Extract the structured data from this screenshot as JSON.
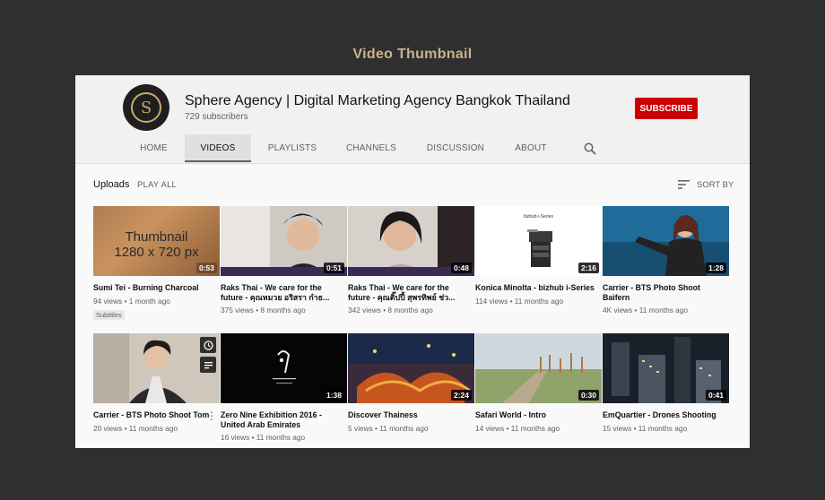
{
  "page": {
    "heading": "Video Thumbnail"
  },
  "channel": {
    "avatar_letter": "S",
    "name": "Sphere Agency | Digital Marketing Agency Bangkok Thailand",
    "subscribers": "729 subscribers",
    "subscribe_label": "SUBSCRIBE",
    "brand_color": "#cc0000"
  },
  "tabs": [
    {
      "label": "HOME",
      "active": false
    },
    {
      "label": "VIDEOS",
      "active": true
    },
    {
      "label": "PLAYLISTS",
      "active": false
    },
    {
      "label": "CHANNELS",
      "active": false
    },
    {
      "label": "DISCUSSION",
      "active": false
    },
    {
      "label": "ABOUT",
      "active": false
    }
  ],
  "uploads": {
    "title": "Uploads",
    "play_all": "PLAY ALL",
    "sort_by": "SORT BY"
  },
  "videos": [
    {
      "placeholder_line1": "Thumbnail",
      "placeholder_line2": "1280 x 720 px",
      "duration": "0:53",
      "title": "Sumi Tei - Burning Charcoal",
      "views": "94 views",
      "age": "1 month ago",
      "badge": "Subtitles"
    },
    {
      "duration": "0:51",
      "title": "Raks Thai - We care for the future - คุณหมวย อริสรา กำธ...",
      "views": "375 views",
      "age": "8 months ago"
    },
    {
      "duration": "0:48",
      "title": "Raks Thai - We care for the future - คุณติ๊ปปี้ สุพรทิพย์ ช่ว...",
      "views": "342 views",
      "age": "8 months ago"
    },
    {
      "duration": "2:16",
      "title": "Konica Minolta - bizhub i-Series",
      "views": "114 views",
      "age": "11 months ago",
      "thumb_text": "bizhub i-Series"
    },
    {
      "duration": "1:28",
      "title": "Carrier - BTS Photo Shoot Baifern",
      "views": "4K views",
      "age": "11 months ago"
    },
    {
      "duration": "",
      "title": "Carrier - BTS Photo Shoot Tom",
      "views": "20 views",
      "age": "11 months ago"
    },
    {
      "duration": "1:38",
      "title": "Zero Nine Exhibition 2016 - United Arab Emirates",
      "views": "16 views",
      "age": "11 months ago"
    },
    {
      "duration": "2:24",
      "title": "Discover Thainess",
      "views": "5 views",
      "age": "11 months ago"
    },
    {
      "duration": "0:30",
      "title": "Safari World - Intro",
      "views": "14 views",
      "age": "11 months ago"
    },
    {
      "duration": "0:41",
      "title": "EmQuartier - Drones Shooting",
      "views": "15 views",
      "age": "11 months ago"
    }
  ]
}
